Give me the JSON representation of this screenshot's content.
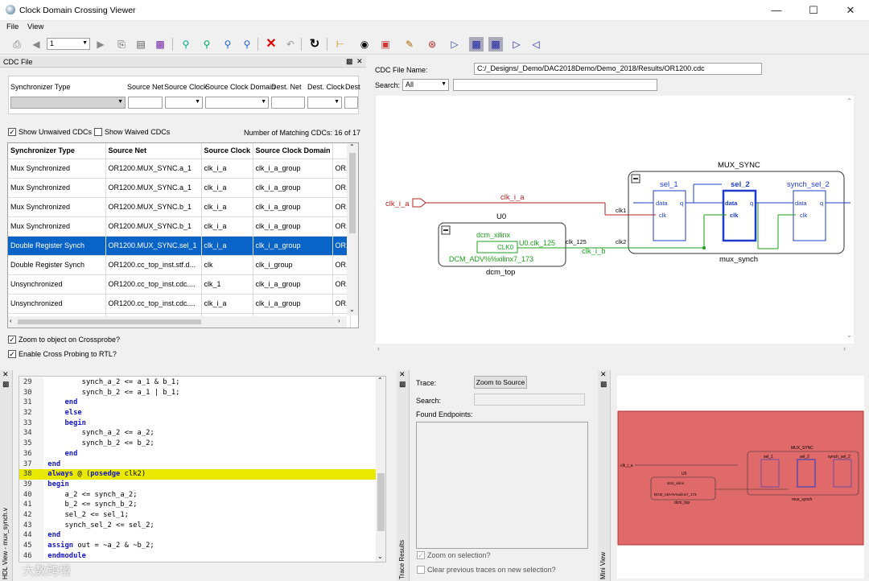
{
  "window": {
    "title": "Clock Domain Crossing Viewer"
  },
  "menu": [
    "File",
    "View"
  ],
  "toolbar": {
    "page_value": "1",
    "icons": [
      "print-icon",
      "back-icon",
      "page-combo",
      "forward-icon",
      "print-preview-icon",
      "page-setup-icon",
      "export-icon",
      "zoom-fit-icon",
      "zoom-in-icon",
      "zoom-out-icon",
      "zoom-area-icon",
      "delete-icon",
      "undo-icon",
      "refresh-icon",
      "pin-icon",
      "binoculars-icon",
      "hierarchy-icon",
      "pencil-icon",
      "net-icon",
      "register-icon",
      "cdc-icon-1",
      "cdc-icon-2",
      "cdc-icon-3",
      "cdc-icon-4"
    ]
  },
  "cdc_panel": {
    "title": "CDC File",
    "filter_labels": [
      "Synchronizer Type",
      "Source Net",
      "Source Clock",
      "Source Clock Domain",
      "Dest. Net",
      "Dest. Clock",
      "Dest"
    ],
    "show_unwaived": "Show Unwaived CDCs",
    "show_waived": "Show Waived CDCs",
    "matching": "Number of Matching CDCs: 16 of 17",
    "columns": [
      "Synchronizer Type",
      "Source Net",
      "Source Clock",
      "Source Clock Domain",
      ""
    ],
    "rows": [
      [
        "Mux Synchronized",
        "OR1200.MUX_SYNC.a_1",
        "clk_i_a",
        "clk_i_a_group",
        "OR1"
      ],
      [
        "Mux Synchronized",
        "OR1200.MUX_SYNC.a_1",
        "clk_i_a",
        "clk_i_a_group",
        "OR1"
      ],
      [
        "Mux Synchronized",
        "OR1200.MUX_SYNC.b_1",
        "clk_i_a",
        "clk_i_a_group",
        "OR1"
      ],
      [
        "Mux Synchronized",
        "OR1200.MUX_SYNC.b_1",
        "clk_i_a",
        "clk_i_a_group",
        "OR1"
      ],
      [
        "Double Register Synch",
        "OR1200.MUX_SYNC.sel_1",
        "clk_i_a",
        "clk_i_a_group",
        "OR1"
      ],
      [
        "Double Register Synch",
        "OR1200.cc_top_inst.stf.d...",
        "clk",
        "clk_i_group",
        "OR1"
      ],
      [
        "Unsynchronized",
        "OR1200.cc_top_inst.cdc....",
        "clk_1",
        "clk_i_a_group",
        "OR1"
      ],
      [
        "Unsynchronized",
        "OR1200.cc_top_inst.cdc....",
        "clk_i_a",
        "clk_i_a_group",
        "OR1"
      ]
    ],
    "selected_row": 4,
    "zoom_crossprobe": "Zoom to object on Crossprobe?",
    "cross_probe": "Enable Cross Probing to RTL?"
  },
  "file_info": {
    "file_label": "CDC File Name:",
    "file_value": "C:/_Designs/_Demo/DAC2018Demo/Demo_2018/Results/OR1200.cdc",
    "search_label": "Search:",
    "search_value": "All"
  },
  "schematic": {
    "mux_sync": "MUX_SYNC",
    "mux_synch": "mux_synch",
    "sel_1": "sel_1",
    "sel_2": "sel_2",
    "synch_sel_2": "synch_sel_2",
    "data": "data",
    "clk": "clk",
    "q": "q",
    "clk_i_a": "clk_i_a",
    "clk_i_b": "clk_i_b",
    "u0": "U0",
    "dcm_xilinx": "dcm_xilinx",
    "clk0": "CLK0",
    "u0_clk": "U0.clk_125",
    "clk_125": "clk_125",
    "dcm_adv": "DCM_ADV%%xilinx7_173",
    "dcm_top": "dcm_top",
    "clk1": "clk1",
    "clk2": "clk2"
  },
  "hdl": {
    "tab": "HDL View - mux_synch.v",
    "lines": [
      {
        "n": "29",
        "t": "        synch_a_2 <= a_1 & b_1;"
      },
      {
        "n": "30",
        "t": "        synch_b_2 <= a_1 | b_1;"
      },
      {
        "n": "31",
        "k": "    end"
      },
      {
        "n": "32",
        "k": "    else"
      },
      {
        "n": "33",
        "k": "    begin"
      },
      {
        "n": "34",
        "t": "        synch_a_2 <= a_2;"
      },
      {
        "n": "35",
        "t": "        synch_b_2 <= b_2;"
      },
      {
        "n": "36",
        "k": "    end"
      },
      {
        "n": "37",
        "k": "end"
      },
      {
        "n": "38",
        "k": "always",
        "t": " @ (",
        "k2": "posedge",
        "t2": " clk2)",
        "hl": true
      },
      {
        "n": "39",
        "k": "begin"
      },
      {
        "n": "40",
        "t": "    a_2 <= synch_a_2;"
      },
      {
        "n": "41",
        "t": "    b_2 <= synch_b_2;"
      },
      {
        "n": "42",
        "t": "    sel_2 <= sel_1;"
      },
      {
        "n": "43",
        "t": "    synch_sel_2 <= sel_2;"
      },
      {
        "n": "44",
        "k": "end"
      },
      {
        "n": "45",
        "k": "assign",
        "t": " out = ~a_2 & ~b_2;"
      },
      {
        "n": "46",
        "k": "endmodule"
      }
    ]
  },
  "trace": {
    "tab": "Trace Results",
    "trace_label": "Trace:",
    "zoom_btn": "Zoom to Source",
    "search_label": "Search:",
    "endpoints": "Found Endpoints:",
    "zoom_sel": "Zoom on selection?",
    "clear_prev": "Clear previous traces on new selection?"
  },
  "mini": {
    "tab": "Mini View",
    "mux_sync": "MUX_SYNC",
    "sel_1": "sel_1",
    "sel_2": "sel_2",
    "synch_sel_2": "synch_sel_2",
    "u0": "U0",
    "dcm_xilinx": "dcm_xilinx",
    "dcm_adv": "DCM_ADV%%xilinx7_173",
    "dcm_top": "dcm_top",
    "mux_synch": "mux_synch",
    "clk_i_a": "clk_i_a"
  },
  "watermark": "大数跨境",
  "colors": {
    "selected": "#0a64c8",
    "highlight": "#e8e800",
    "clk_a": "#b22222",
    "clk_b": "#1aa01a",
    "reg": "#1e3cc8",
    "mini": "#e06a6a"
  }
}
